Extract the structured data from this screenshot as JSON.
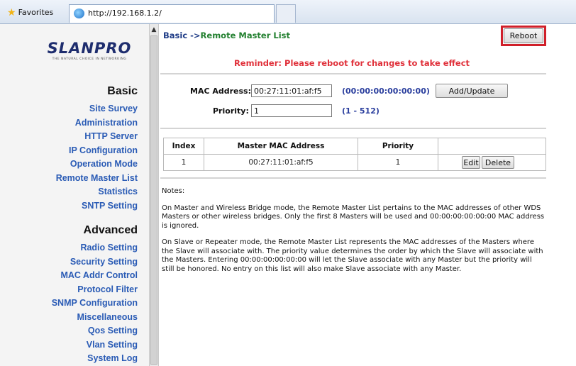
{
  "browser": {
    "favorites_label": "Favorites",
    "url": "http://192.168.1.2/"
  },
  "logo": {
    "name": "SLANPRO",
    "tagline": "THE NATURAL CHOICE IN NETWORKING"
  },
  "nav": {
    "basic_heading": "Basic",
    "basic_items": [
      "Site Survey",
      "Administration",
      "HTTP Server",
      "IP Configuration",
      "Operation Mode",
      "Remote Master List",
      "Statistics",
      "SNTP Setting"
    ],
    "advanced_heading": "Advanced",
    "advanced_items": [
      "Radio Setting",
      "Security Setting",
      "MAC Addr Control",
      "Protocol Filter",
      "SNMP Configuration",
      "Miscellaneous",
      "Qos Setting",
      "Vlan Setting",
      "System Log"
    ]
  },
  "main": {
    "breadcrumb_prefix": "Basic ->",
    "breadcrumb_current": "Remote Master List",
    "reboot_label": "Reboot",
    "reminder": "Reminder: Please reboot for changes to take effect",
    "mac_label": "MAC Address:",
    "mac_value": "00:27:11:01:af:f5",
    "mac_hint": "(00:00:00:00:00:00)",
    "add_update_label": "Add/Update",
    "priority_label": "Priority:",
    "priority_value": "1",
    "priority_hint": "(1 - 512)",
    "table": {
      "headers": [
        "Index",
        "Master MAC Address",
        "Priority",
        ""
      ],
      "rows": [
        {
          "index": "1",
          "mac": "00:27:11:01:af:f5",
          "priority": "1",
          "edit_label": "Edit",
          "delete_label": "Delete"
        }
      ]
    },
    "notes_label": "Notes:",
    "notes": [
      "On Master and Wireless Bridge mode, the Remote Master List pertains to the MAC addresses of other WDS Masters or other wireless bridges. Only the first 8 Masters will be used and 00:00:00:00:00:00 MAC address is ignored.",
      "On Slave or Repeater mode, the Remote Master List represents the MAC addresses of the Masters where the Slave will associate with. The priority value determines the order by which the Slave will associate with the Masters. Entering 00:00:00:00:00:00 will let the Slave associate with any Master but the priority will still be honored. No entry on this list will also make Slave associate with any Master."
    ]
  }
}
